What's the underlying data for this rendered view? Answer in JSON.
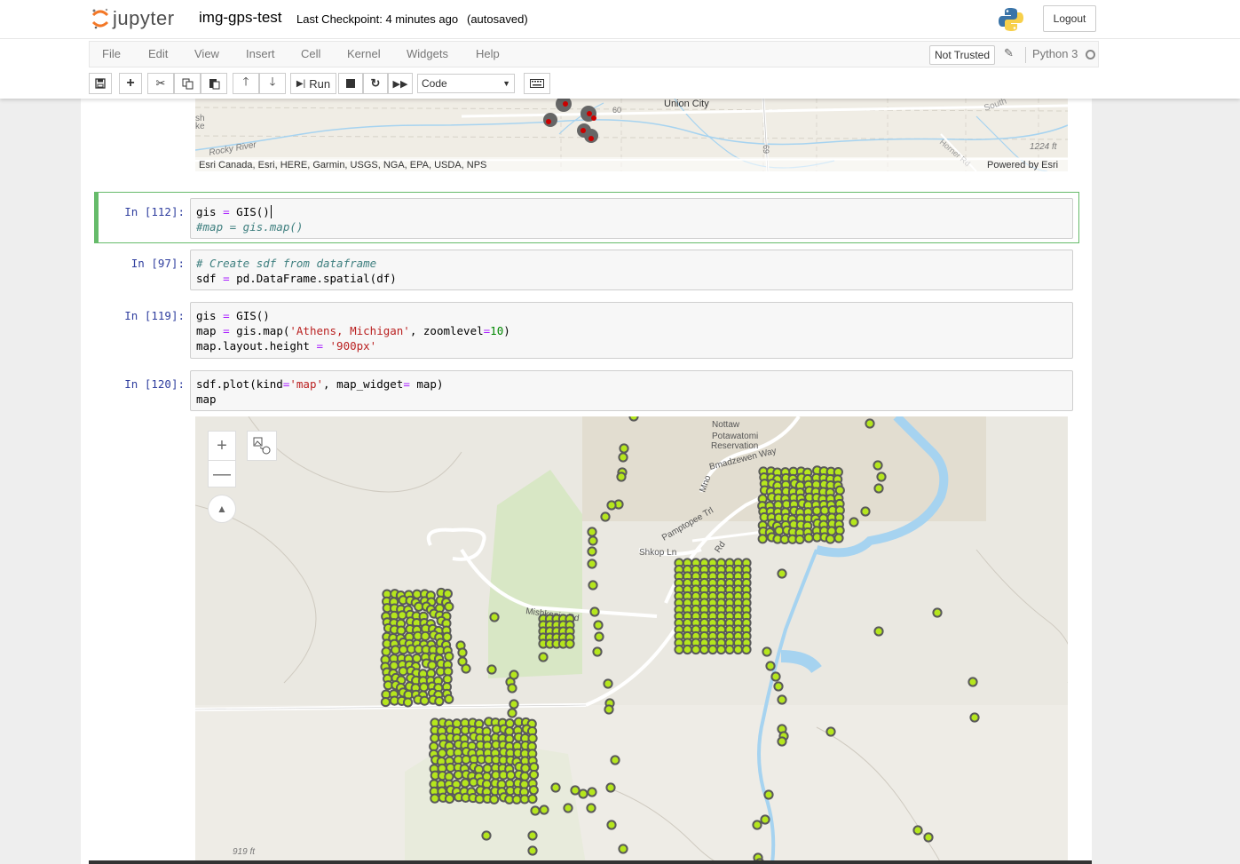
{
  "header": {
    "logo_text": "jupyter",
    "notebook_name": "img-gps-test",
    "checkpoint": "Last Checkpoint: 4 minutes ago",
    "autosaved": "(autosaved)",
    "logout_label": "Logout"
  },
  "menubar": {
    "items": [
      "File",
      "Edit",
      "View",
      "Insert",
      "Cell",
      "Kernel",
      "Widgets",
      "Help"
    ],
    "trust_label": "Not Trusted",
    "kernel_name": "Python 3"
  },
  "toolbar": {
    "run_label": "Run",
    "cell_type": "Code"
  },
  "map_top": {
    "attribution": "Esri Canada, Esri, HERE, Garmin, USGS, NGA, EPA, USDA, NPS",
    "powered_by": "Powered by Esri",
    "place_union_city": "Union City",
    "place_rocky_river": "Rocky River",
    "elevation": "1224 ft",
    "road_60": "60",
    "road_69": "69",
    "place_south": "South",
    "place_horner": "Horner Rd",
    "place_sh": "sh",
    "place_ke": "ke"
  },
  "cells": [
    {
      "prompt": "In [112]:",
      "lines": [
        "gis = GIS()",
        "#map = gis.map()"
      ]
    },
    {
      "prompt": "In [97]:",
      "lines": [
        "# Create sdf from dataframe",
        "sdf = pd.DataFrame.spatial(df)"
      ]
    },
    {
      "prompt": "In [119]:",
      "lines": [
        "gis = GIS()",
        "map = gis.map('Athens, Michigan', zoomlevel=10)",
        "map.layout.height = '900px'"
      ]
    },
    {
      "prompt": "In [120]:",
      "lines": [
        "sdf.plot(kind='map', map_widget= map)",
        "map"
      ]
    }
  ],
  "map_main": {
    "label_potawatomi": "Potawatomi",
    "label_reservation": "Reservation",
    "label_nottawa": "Nottaw",
    "road_bmadzewen": "Bmadzewen Way",
    "road_mno": "Mno",
    "road_pamptopee": "Pamptopee Trl",
    "road_shkop": "Shkop Ln",
    "road_rd": "Rd",
    "road_mishkopin": "Mishkopin Rd",
    "elevation": "919 ft",
    "zoom_in": "+",
    "zoom_out": "—"
  },
  "colors": {
    "point_fill": "#b5e61d",
    "point_stroke": "#5a5a5a",
    "river": "#a6d3f0",
    "park": "#d9e8c2",
    "selected_border": "#66bb6a",
    "prompt": "#303F9F"
  }
}
